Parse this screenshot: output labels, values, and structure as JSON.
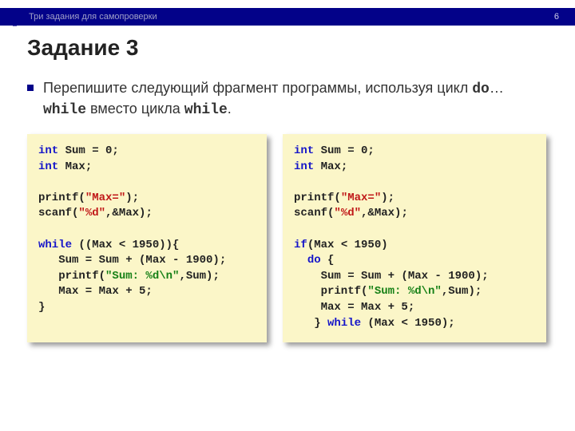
{
  "header": {
    "section_title": "Три задания для самопроверки",
    "page_number": "6"
  },
  "title": "Задание 3",
  "instruction": {
    "pre": "Перепишите следующий фрагмент программы, используя цикл ",
    "kw1": "do",
    "mid": "…",
    "kw2": "while",
    "mid2": " вместо цикла ",
    "kw3": "while",
    "post": "."
  },
  "code_left": {
    "l1a": "int",
    "l1b": " Sum = 0;",
    "l2a": "int",
    "l2b": " Max;",
    "l3": "",
    "l4a": "printf(",
    "l4b": "\"Max=\"",
    "l4c": ");",
    "l5a": "scanf(",
    "l5b": "\"%d\"",
    "l5c": ",&Max);",
    "l6": "",
    "l7a": "while",
    "l7b": " ((Max < 1950)){",
    "l8": "   Sum = Sum + (Max - 1900);",
    "l9a": "   printf(",
    "l9b": "\"Sum: %d\\n\"",
    "l9c": ",Sum);",
    "l10": "   Max = Max + 5;",
    "l11": "}"
  },
  "code_right": {
    "l1a": "int",
    "l1b": " Sum = 0;",
    "l2a": "int",
    "l2b": " Max;",
    "l3": "",
    "l4a": "printf(",
    "l4b": "\"Max=\"",
    "l4c": ");",
    "l5a": "scanf(",
    "l5b": "\"%d\"",
    "l5c": ",&Max);",
    "l6": "",
    "l7a": "if",
    "l7b": "(Max < 1950)",
    "l8a": "  ",
    "l8b": "do",
    "l8c": " {",
    "l9": "    Sum = Sum + (Max - 1900);",
    "l10a": "    printf(",
    "l10b": "\"Sum: %d\\n\"",
    "l10c": ",Sum);",
    "l11": "    Max = Max + 5;",
    "l12a": "   } ",
    "l12b": "while",
    "l12c": " (Max < 1950);"
  }
}
